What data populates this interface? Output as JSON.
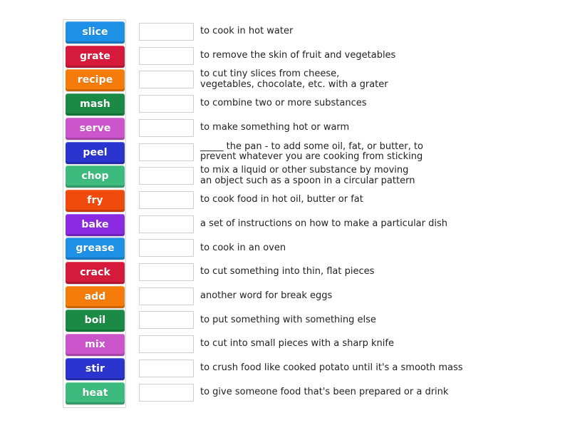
{
  "activity": {
    "type": "match-up",
    "tiles": [
      {
        "label": "slice",
        "color": "#1e90e6"
      },
      {
        "label": "grate",
        "color": "#d61a3c"
      },
      {
        "label": "recipe",
        "color": "#f57c0a"
      },
      {
        "label": "mash",
        "color": "#1a8a45"
      },
      {
        "label": "serve",
        "color": "#cc55cc"
      },
      {
        "label": "peel",
        "color": "#2a35d0"
      },
      {
        "label": "chop",
        "color": "#3dba7e"
      },
      {
        "label": "fry",
        "color": "#f04a0c"
      },
      {
        "label": "bake",
        "color": "#8a2be2"
      },
      {
        "label": "grease",
        "color": "#1e90e6"
      },
      {
        "label": "crack",
        "color": "#d61a3c"
      },
      {
        "label": "add",
        "color": "#f57c0a"
      },
      {
        "label": "boil",
        "color": "#1a8a45"
      },
      {
        "label": "mix",
        "color": "#cc55cc"
      },
      {
        "label": "stir",
        "color": "#2a35d0"
      },
      {
        "label": "heat",
        "color": "#3dba7e"
      }
    ],
    "rows": [
      {
        "answer": "",
        "definition": "to cook in hot water"
      },
      {
        "answer": "",
        "definition": "to remove the skin of fruit and vegetables"
      },
      {
        "answer": "",
        "definition": "to cut tiny slices from cheese,\nvegetables, chocolate, etc. with a grater"
      },
      {
        "answer": "",
        "definition": "to combine two or more substances"
      },
      {
        "answer": "",
        "definition": "to make something hot or warm"
      },
      {
        "answer": "",
        "definition": "_____ the pan - to add some oil, fat, or butter, to\nprevent whatever you are cooking from sticking"
      },
      {
        "answer": "",
        "definition": "to mix a liquid or other substance by moving\nan object such as a spoon in a circular pattern"
      },
      {
        "answer": "",
        "definition": "to cook food in hot oil, butter or fat"
      },
      {
        "answer": "",
        "definition": "a set of instructions on how to make a particular dish"
      },
      {
        "answer": "",
        "definition": "to cook in an oven"
      },
      {
        "answer": "",
        "definition": "to cut something into thin, flat pieces"
      },
      {
        "answer": "",
        "definition": "another word for break eggs"
      },
      {
        "answer": "",
        "definition": "to put something with something else"
      },
      {
        "answer": "",
        "definition": "to cut into small pieces with a sharp knife"
      },
      {
        "answer": "",
        "definition": "to crush food like cooked potato until it's a smooth mass"
      },
      {
        "answer": "",
        "definition": "to give someone food that's been prepared or a drink"
      }
    ]
  }
}
